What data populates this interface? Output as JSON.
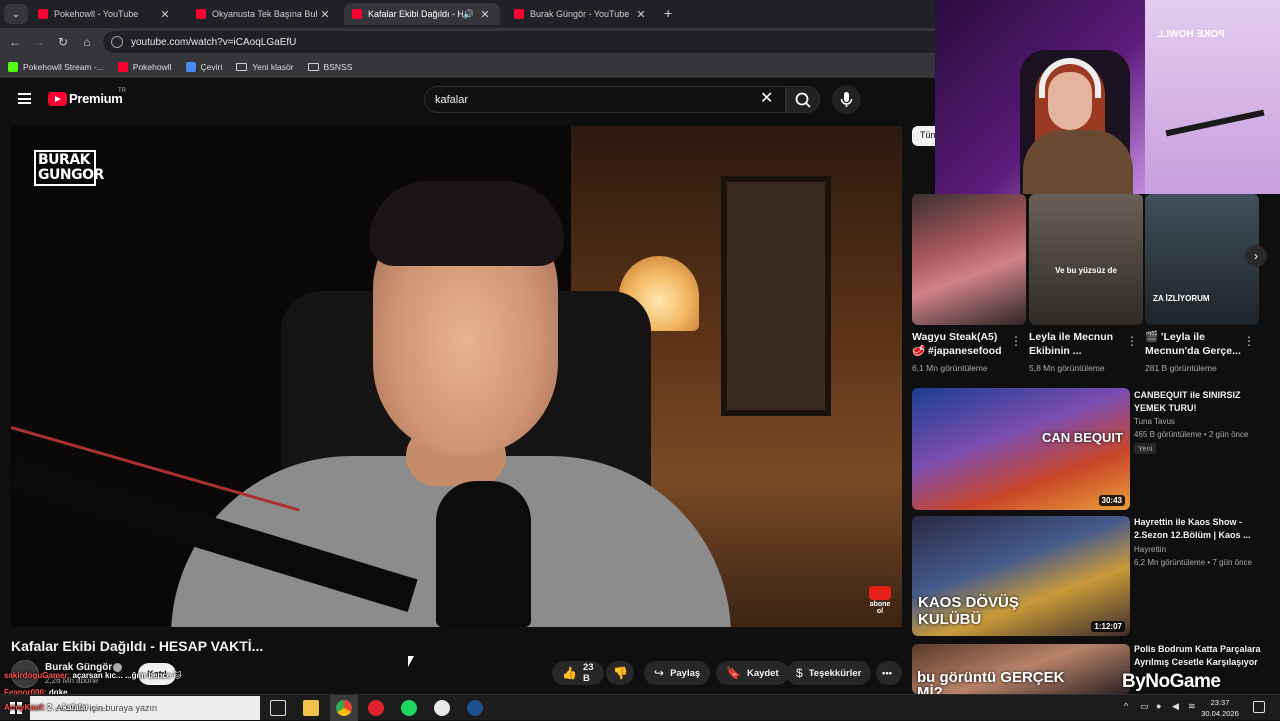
{
  "browser": {
    "tabs": [
      {
        "label": "Pokehowll - YouTube"
      },
      {
        "label": "Okyanusta Tek Başına Bulunan Ç"
      },
      {
        "label": "Kafalar Ekibi Dağıldı - HESA"
      },
      {
        "label": "Burak Güngör - YouTube"
      }
    ],
    "url": "youtube.com/watch?v=iCAoqLGaEfU",
    "bookmarks": [
      {
        "label": "Pokehowll Stream -..."
      },
      {
        "label": "Pokehowll"
      },
      {
        "label": "Çeviri"
      },
      {
        "label": "Yeni klasör"
      },
      {
        "label": "BSNSS"
      }
    ]
  },
  "youtube": {
    "logo_label": "Premium",
    "logo_country": "TR",
    "search_value": "kafalar",
    "chip_label": "Tüm",
    "video": {
      "overlay_logo": "BURAK GUNGOR",
      "subscribe_badge": "abone ol",
      "title": "Kafalar Ekibi Dağıldı - HESAP VAKTİ...",
      "channel": "Burak Güngör",
      "subscribers": "2,26 Mn abone",
      "join_label": "Katıl",
      "likes": "23 B",
      "share_label": "Paylaş",
      "save_label": "Kaydet",
      "thanks_label": "Teşekkürler",
      "more_label": "•••"
    },
    "shorts": [
      {
        "title": "Wagyu Steak(A5) 🥩 #japanesefood",
        "views": "6,1 Mn görüntüleme",
        "caption": ""
      },
      {
        "title": "Leyla ile Mecnun Ekibinin ...",
        "views": "5,8 Mn görüntüleme",
        "caption": "Ve bu yüzsüz de"
      },
      {
        "title": "🎬 'Leyla ile Mecnun'da Gerçe...",
        "views": "281 B görüntüleme",
        "caption": "ZA İZLİYORUM"
      }
    ],
    "related": [
      {
        "title": "CANBEQUIT ile SINIRSIZ YEMEK TURU!",
        "channel": "Tuna Tavus",
        "meta": "465 B görüntüleme • 2 gün önce",
        "badge": "Yeni",
        "duration": "30:43",
        "thumb_text": "CAN BEQUIT"
      },
      {
        "title": "Hayrettin ile Kaos Show - 2.Sezon 12.Bölüm | Kaos ...",
        "channel": "Hayrettin",
        "meta": "6,2 Mn görüntüleme • 7 gün önce",
        "duration": "1:12:07",
        "thumb_text": "KAOS DÖVÜŞ KULÜBÜ"
      },
      {
        "title": "Polis Bodrum Katta Parçalara Ayrılmış Cesetle Karşılaşıyor",
        "thumb_text": "bu görüntü GERÇEK Mİ?"
      }
    ]
  },
  "stream": {
    "cam_logo": "POKE HOWLL",
    "chat": [
      {
        "user": "Feanor000",
        "text": "dqke"
      },
      {
        "user": "sakirdoguGamer",
        "text": "açarsan kıc... ...ğım bence 🐱"
      },
      {
        "user": "ArmyKauf",
        "text": "2 ... kafalar ... ..."
      }
    ],
    "watermark": "ByNoGame"
  },
  "taskbar": {
    "search_placeholder": "Aramak için buraya yazın",
    "time": "23:37",
    "date": "30.04.2026"
  },
  "colors": {
    "youtube_red": "#ff0033",
    "bg": "#0f0f0f",
    "chrome_bar": "#35363a"
  }
}
